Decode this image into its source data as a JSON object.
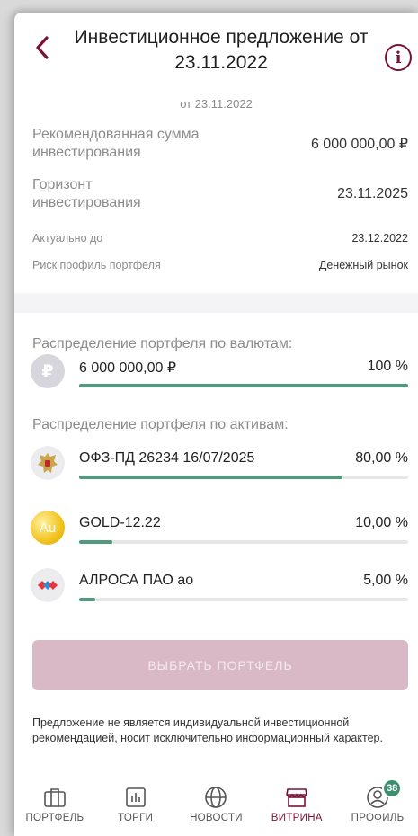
{
  "header": {
    "title": "Инвестиционное предложение от 23.11.2022",
    "subtitle": "от 23.11.2022"
  },
  "details": {
    "amount_label": "Рекомендованная сумма инвестирования",
    "amount_value": "6 000 000,00 ₽",
    "horizon_label": "Горизонт инвестирования",
    "horizon_value": "23.11.2025",
    "actual_label": "Актуально до",
    "actual_value": "23.12.2022",
    "risk_label": "Риск профиль портфеля",
    "risk_value": "Денежный рынок"
  },
  "currency_section": {
    "title": "Распределение портфеля по валютам:",
    "items": [
      {
        "icon": "ruble-icon",
        "glyph": "₽",
        "name": "6 000 000,00 ₽",
        "percent": "100 %",
        "share": 1.0
      }
    ]
  },
  "assets_section": {
    "title": "Распределение портфеля по активам:",
    "items": [
      {
        "icon": "coat-of-arms-icon",
        "name": "ОФЗ-ПД 26234 16/07/2025",
        "percent": "80,00 %",
        "share": 0.8
      },
      {
        "icon": "gold-coin-icon",
        "glyph": "Au",
        "name": "GOLD-12.22",
        "percent": "10,00 %",
        "share": 0.1
      },
      {
        "icon": "alrosa-logo-icon",
        "name": "АЛРОСА ПАО ао",
        "percent": "5,00 %",
        "share": 0.05
      }
    ]
  },
  "actions": {
    "select_label": "ВЫБРАТЬ ПОРТФЕЛЬ"
  },
  "disclaimer": "Предложение не является индивидуальной инвестиционной рекомендацией, носит исключительно информационный характер.",
  "tabbar": {
    "tabs": [
      {
        "label": "ПОРТФЕЛЬ",
        "icon": "briefcase-icon"
      },
      {
        "label": "ТОРГИ",
        "icon": "chart-icon"
      },
      {
        "label": "НОВОСТИ",
        "icon": "globe-icon"
      },
      {
        "label": "ВИТРИНА",
        "icon": "storefront-icon",
        "active": true
      },
      {
        "label": "ПРОФИЛЬ",
        "icon": "profile-icon",
        "badge": "38"
      }
    ]
  },
  "colors": {
    "accent": "#7a1238",
    "progress": "#4f9a7a",
    "button_disabled": "#d9b9c6",
    "badge": "#3a8f6e"
  }
}
